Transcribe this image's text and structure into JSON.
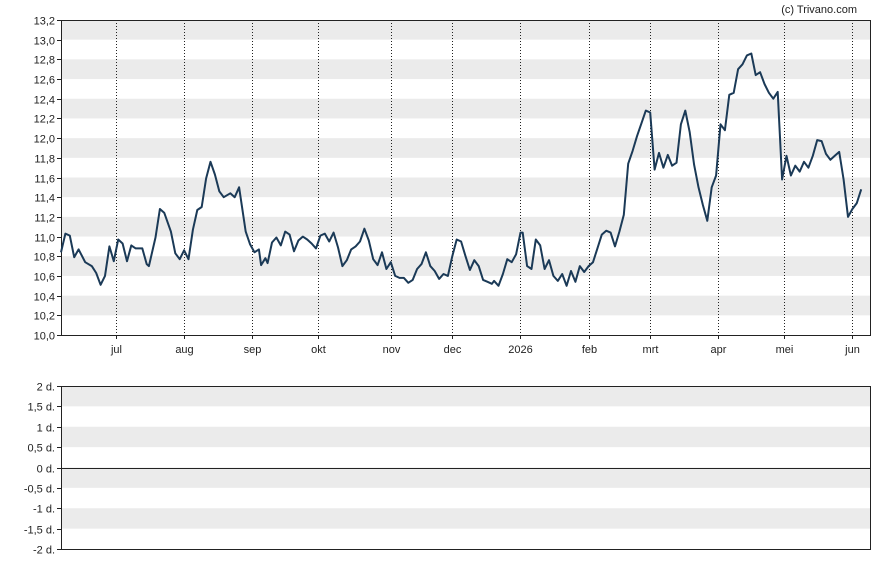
{
  "credit": "(c) Trivano.com",
  "chart_data": [
    {
      "type": "line",
      "ylim": [
        10.0,
        13.2
      ],
      "yticks": [
        10.0,
        10.2,
        10.4,
        10.6,
        10.8,
        11.0,
        11.2,
        11.4,
        11.6,
        11.8,
        12.0,
        12.2,
        12.4,
        12.6,
        12.8,
        13.0,
        13.2
      ],
      "ytick_labels": [
        "10,0",
        "10,2",
        "10,4",
        "10,6",
        "10,8",
        "11,0",
        "11,2",
        "11,4",
        "11,6",
        "11,8",
        "12,0",
        "12,2",
        "12,4",
        "12,6",
        "12,8",
        "13,0",
        "13,2"
      ],
      "x_start": "2025-06-06",
      "x_end": "2026-06-09",
      "xticks": [
        {
          "date": "2025-07-01",
          "label": "jul"
        },
        {
          "date": "2025-08-01",
          "label": "aug"
        },
        {
          "date": "2025-09-01",
          "label": "sep"
        },
        {
          "date": "2025-10-01",
          "label": "okt"
        },
        {
          "date": "2025-11-03",
          "label": "nov"
        },
        {
          "date": "2025-12-01",
          "label": "dec"
        },
        {
          "date": "2026-01-01",
          "label": "2026"
        },
        {
          "date": "2026-02-01",
          "label": "feb"
        },
        {
          "date": "2026-03-01",
          "label": "mrt"
        },
        {
          "date": "2026-04-01",
          "label": "apr"
        },
        {
          "date": "2026-05-01",
          "label": "mei"
        },
        {
          "date": "2026-06-01",
          "label": "jun"
        }
      ],
      "grid": "horizontal bands, dotted vertical lines at month starts",
      "line_color": "#1b3a57",
      "band_color": "#ebebeb",
      "series": [
        {
          "points": [
            [
              "2025-06-06",
              10.84
            ],
            [
              "2025-06-08",
              11.03
            ],
            [
              "2025-06-10",
              11.01
            ],
            [
              "2025-06-12",
              10.79
            ],
            [
              "2025-06-14",
              10.87
            ],
            [
              "2025-06-17",
              10.74
            ],
            [
              "2025-06-20",
              10.7
            ],
            [
              "2025-06-22",
              10.63
            ],
            [
              "2025-06-24",
              10.51
            ],
            [
              "2025-06-26",
              10.6
            ],
            [
              "2025-06-28",
              10.9
            ],
            [
              "2025-06-30",
              10.75
            ],
            [
              "2025-07-02",
              10.97
            ],
            [
              "2025-07-04",
              10.93
            ],
            [
              "2025-07-06",
              10.75
            ],
            [
              "2025-07-08",
              10.91
            ],
            [
              "2025-07-10",
              10.88
            ],
            [
              "2025-07-13",
              10.88
            ],
            [
              "2025-07-15",
              10.72
            ],
            [
              "2025-07-16",
              10.7
            ],
            [
              "2025-07-19",
              10.99
            ],
            [
              "2025-07-21",
              11.28
            ],
            [
              "2025-07-23",
              11.24
            ],
            [
              "2025-07-26",
              11.05
            ],
            [
              "2025-07-28",
              10.83
            ],
            [
              "2025-07-30",
              10.77
            ],
            [
              "2025-08-01",
              10.86
            ],
            [
              "2025-08-03",
              10.77
            ],
            [
              "2025-08-05",
              11.07
            ],
            [
              "2025-08-07",
              11.27
            ],
            [
              "2025-08-09",
              11.3
            ],
            [
              "2025-08-11",
              11.59
            ],
            [
              "2025-08-13",
              11.76
            ],
            [
              "2025-08-15",
              11.63
            ],
            [
              "2025-08-17",
              11.46
            ],
            [
              "2025-08-19",
              11.4
            ],
            [
              "2025-08-22",
              11.44
            ],
            [
              "2025-08-24",
              11.4
            ],
            [
              "2025-08-26",
              11.5
            ],
            [
              "2025-08-29",
              11.05
            ],
            [
              "2025-08-31",
              10.92
            ],
            [
              "2025-09-02",
              10.84
            ],
            [
              "2025-09-04",
              10.87
            ],
            [
              "2025-09-05",
              10.71
            ],
            [
              "2025-09-07",
              10.78
            ],
            [
              "2025-09-08",
              10.73
            ],
            [
              "2025-09-10",
              10.94
            ],
            [
              "2025-09-12",
              10.99
            ],
            [
              "2025-09-14",
              10.91
            ],
            [
              "2025-09-16",
              11.05
            ],
            [
              "2025-09-18",
              11.02
            ],
            [
              "2025-09-20",
              10.85
            ],
            [
              "2025-09-22",
              10.96
            ],
            [
              "2025-09-24",
              11.0
            ],
            [
              "2025-09-26",
              10.97
            ],
            [
              "2025-09-28",
              10.93
            ],
            [
              "2025-09-30",
              10.88
            ],
            [
              "2025-10-02",
              11.01
            ],
            [
              "2025-10-04",
              11.03
            ],
            [
              "2025-10-06",
              10.95
            ],
            [
              "2025-10-08",
              11.04
            ],
            [
              "2025-10-10",
              10.89
            ],
            [
              "2025-10-12",
              10.7
            ],
            [
              "2025-10-14",
              10.76
            ],
            [
              "2025-10-16",
              10.87
            ],
            [
              "2025-10-18",
              10.9
            ],
            [
              "2025-10-20",
              10.95
            ],
            [
              "2025-10-22",
              11.08
            ],
            [
              "2025-10-24",
              10.96
            ],
            [
              "2025-10-26",
              10.77
            ],
            [
              "2025-10-28",
              10.71
            ],
            [
              "2025-10-30",
              10.84
            ],
            [
              "2025-11-01",
              10.67
            ],
            [
              "2025-11-03",
              10.74
            ],
            [
              "2025-11-05",
              10.6
            ],
            [
              "2025-11-07",
              10.58
            ],
            [
              "2025-11-09",
              10.58
            ],
            [
              "2025-11-11",
              10.53
            ],
            [
              "2025-11-13",
              10.56
            ],
            [
              "2025-11-15",
              10.67
            ],
            [
              "2025-11-17",
              10.72
            ],
            [
              "2025-11-19",
              10.84
            ],
            [
              "2025-11-21",
              10.7
            ],
            [
              "2025-11-23",
              10.65
            ],
            [
              "2025-11-25",
              10.57
            ],
            [
              "2025-11-27",
              10.62
            ],
            [
              "2025-11-29",
              10.6
            ],
            [
              "2025-12-01",
              10.8
            ],
            [
              "2025-12-03",
              10.97
            ],
            [
              "2025-12-05",
              10.95
            ],
            [
              "2025-12-07",
              10.8
            ],
            [
              "2025-12-09",
              10.66
            ],
            [
              "2025-12-11",
              10.76
            ],
            [
              "2025-12-13",
              10.7
            ],
            [
              "2025-12-15",
              10.56
            ],
            [
              "2025-12-17",
              10.54
            ],
            [
              "2025-12-19",
              10.52
            ],
            [
              "2025-12-20",
              10.55
            ],
            [
              "2025-12-22",
              10.5
            ],
            [
              "2025-12-24",
              10.62
            ],
            [
              "2025-12-26",
              10.77
            ],
            [
              "2025-12-28",
              10.74
            ],
            [
              "2025-12-30",
              10.82
            ],
            [
              "2026-01-01",
              11.04
            ],
            [
              "2026-01-02",
              11.04
            ],
            [
              "2026-01-04",
              10.7
            ],
            [
              "2026-01-06",
              10.67
            ],
            [
              "2026-01-08",
              10.97
            ],
            [
              "2026-01-10",
              10.91
            ],
            [
              "2026-01-12",
              10.67
            ],
            [
              "2026-01-14",
              10.76
            ],
            [
              "2026-01-16",
              10.6
            ],
            [
              "2026-01-18",
              10.55
            ],
            [
              "2026-01-20",
              10.62
            ],
            [
              "2026-01-22",
              10.5
            ],
            [
              "2026-01-24",
              10.65
            ],
            [
              "2026-01-26",
              10.54
            ],
            [
              "2026-01-28",
              10.7
            ],
            [
              "2026-01-30",
              10.64
            ],
            [
              "2026-02-01",
              10.7
            ],
            [
              "2026-02-03",
              10.74
            ],
            [
              "2026-02-05",
              10.88
            ],
            [
              "2026-02-07",
              11.02
            ],
            [
              "2026-02-09",
              11.06
            ],
            [
              "2026-02-11",
              11.04
            ],
            [
              "2026-02-13",
              10.9
            ],
            [
              "2026-02-15",
              11.05
            ],
            [
              "2026-02-17",
              11.22
            ],
            [
              "2026-02-19",
              11.74
            ],
            [
              "2026-02-21",
              11.87
            ],
            [
              "2026-02-23",
              12.02
            ],
            [
              "2026-02-25",
              12.15
            ],
            [
              "2026-02-27",
              12.28
            ],
            [
              "2026-03-01",
              12.26
            ],
            [
              "2026-03-03",
              11.68
            ],
            [
              "2026-03-05",
              11.85
            ],
            [
              "2026-03-07",
              11.7
            ],
            [
              "2026-03-09",
              11.83
            ],
            [
              "2026-03-11",
              11.72
            ],
            [
              "2026-03-13",
              11.75
            ],
            [
              "2026-03-15",
              12.14
            ],
            [
              "2026-03-17",
              12.28
            ],
            [
              "2026-03-19",
              12.06
            ],
            [
              "2026-03-21",
              11.73
            ],
            [
              "2026-03-23",
              11.5
            ],
            [
              "2026-03-25",
              11.32
            ],
            [
              "2026-03-27",
              11.16
            ],
            [
              "2026-03-29",
              11.5
            ],
            [
              "2026-03-31",
              11.62
            ],
            [
              "2026-04-02",
              12.14
            ],
            [
              "2026-04-04",
              12.08
            ],
            [
              "2026-04-06",
              12.44
            ],
            [
              "2026-04-08",
              12.46
            ],
            [
              "2026-04-10",
              12.7
            ],
            [
              "2026-04-12",
              12.75
            ],
            [
              "2026-04-14",
              12.84
            ],
            [
              "2026-04-16",
              12.86
            ],
            [
              "2026-04-18",
              12.64
            ],
            [
              "2026-04-20",
              12.67
            ],
            [
              "2026-04-22",
              12.55
            ],
            [
              "2026-04-24",
              12.46
            ],
            [
              "2026-04-26",
              12.4
            ],
            [
              "2026-04-28",
              12.47
            ],
            [
              "2026-04-30",
              11.58
            ],
            [
              "2026-05-02",
              11.82
            ],
            [
              "2026-05-04",
              11.62
            ],
            [
              "2026-05-06",
              11.72
            ],
            [
              "2026-05-08",
              11.66
            ],
            [
              "2026-05-10",
              11.76
            ],
            [
              "2026-05-12",
              11.7
            ],
            [
              "2026-05-14",
              11.82
            ],
            [
              "2026-05-16",
              11.98
            ],
            [
              "2026-05-18",
              11.97
            ],
            [
              "2026-05-20",
              11.84
            ],
            [
              "2026-05-22",
              11.78
            ],
            [
              "2026-05-24",
              11.82
            ],
            [
              "2026-05-26",
              11.86
            ],
            [
              "2026-05-28",
              11.58
            ],
            [
              "2026-05-30",
              11.2
            ],
            [
              "2026-06-01",
              11.28
            ],
            [
              "2026-06-03",
              11.34
            ],
            [
              "2026-06-05",
              11.48
            ]
          ]
        }
      ]
    },
    {
      "type": "line",
      "ylim": [
        -2,
        2
      ],
      "yticks": [
        -2,
        -1.5,
        -1,
        -0.5,
        0,
        0.5,
        1,
        1.5,
        2
      ],
      "ytick_labels": [
        "-2 d.",
        "-1,5 d.",
        "-1 d.",
        "-0,5 d.",
        "0 d.",
        "0,5 d.",
        "1 d.",
        "1,5 d.",
        "2 d."
      ],
      "zero_line": 0,
      "grid": "horizontal bands"
    }
  ]
}
